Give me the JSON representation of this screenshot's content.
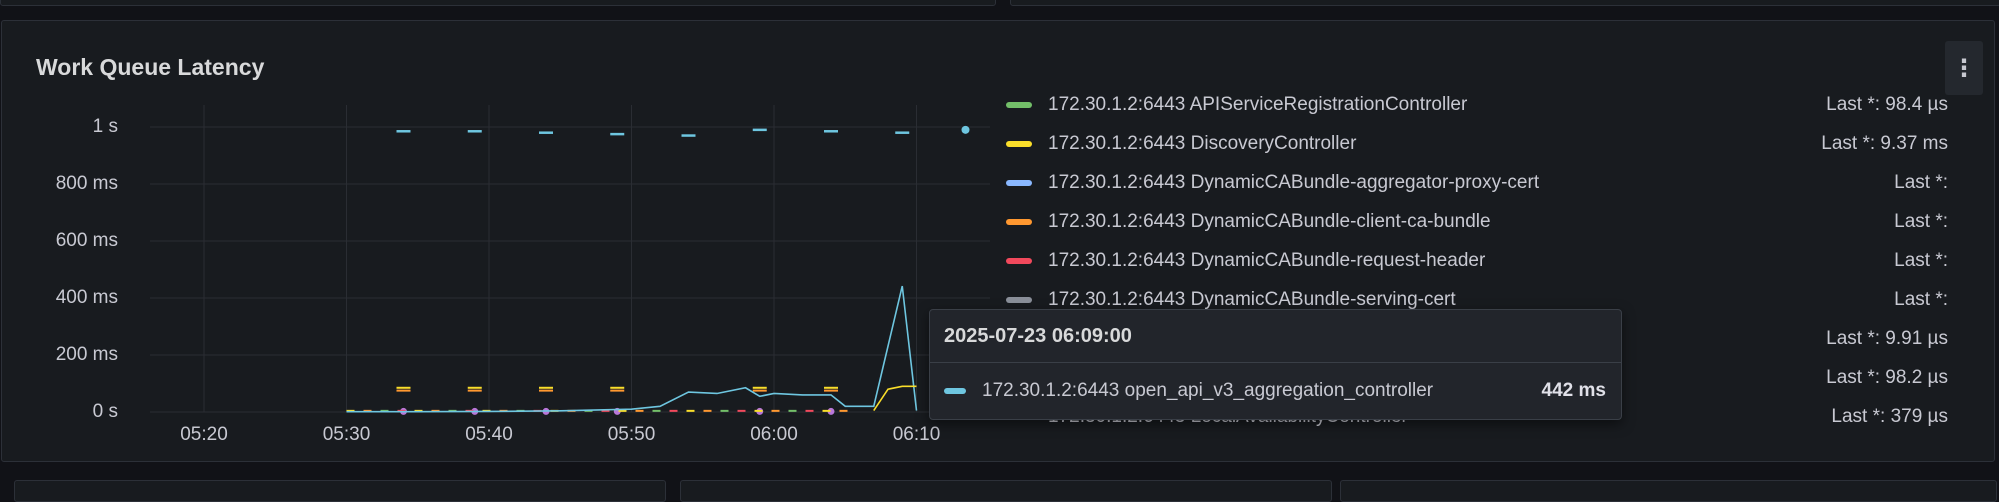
{
  "panel": {
    "title": "Work Queue Latency",
    "menu_icon": "kebab-menu-icon"
  },
  "colors": {
    "background": "#111217",
    "panel": "#181b1f",
    "grid": "#2a2d33",
    "green": "#73bf69",
    "yellow": "#fade2a",
    "blue": "#8ab8ff",
    "orange": "#ff9830",
    "red": "#f2495c",
    "cyan": "#6ec6e0",
    "dark_green": "#37872d"
  },
  "legend": [
    {
      "name": "172.30.1.2:6443 APIServiceRegistrationController",
      "last": "Last *: 98.4 µs",
      "color": "#73bf69"
    },
    {
      "name": "172.30.1.2:6443 DiscoveryController",
      "last": "Last *: 9.37 ms",
      "color": "#fade2a"
    },
    {
      "name": "172.30.1.2:6443 DynamicCABundle-aggregator-proxy-cert",
      "last": "Last *:",
      "color": "#8ab8ff"
    },
    {
      "name": "172.30.1.2:6443 DynamicCABundle-client-ca-bundle",
      "last": "Last *:",
      "color": "#ff9830"
    },
    {
      "name": "172.30.1.2:6443 DynamicCABundle-request-header",
      "last": "Last *:",
      "color": "#f2495c"
    },
    {
      "name": "172.30.1.2:6443 DynamicCABundle-serving-cert",
      "last": "Last *:",
      "color": "#8a8f99"
    },
    {
      "name": "",
      "last": "Last *: 9.91 µs",
      "color": "#b877d9"
    },
    {
      "name": "",
      "last": "Last *: 98.2 µs",
      "color": "#6ec6e0"
    },
    {
      "name": "172.30.1.2:6443 LocalAvailabilityController",
      "last": "Last *: 379 µs",
      "color": "#37872d"
    }
  ],
  "tooltip": {
    "time": "2025-07-23 06:09:00",
    "series": "172.30.1.2:6443 open_api_v3_aggregation_controller",
    "value": "442 ms"
  },
  "chart_data": {
    "type": "line",
    "y_unit": "s",
    "ylim": [
      0,
      1.1
    ],
    "y_ticks": [
      "1 s",
      "800 ms",
      "600 ms",
      "400 ms",
      "200 ms",
      "0 s"
    ],
    "y_tick_values": [
      1.0,
      0.8,
      0.6,
      0.4,
      0.2,
      0.0
    ],
    "x_ticks": [
      "05:20",
      "05:30",
      "05:40",
      "05:50",
      "06:00",
      "06:10"
    ],
    "grid": true,
    "series": [
      {
        "name": "172.30.1.2:6443 open_api_v3_aggregation_controller",
        "color": "#6ec6e0",
        "points": [
          [
            "05:30",
            0.001
          ],
          [
            "05:35",
            0.001
          ],
          [
            "05:40",
            0.002
          ],
          [
            "05:45",
            0.004
          ],
          [
            "05:50",
            0.01
          ],
          [
            "05:52",
            0.02
          ],
          [
            "05:54",
            0.07
          ],
          [
            "05:56",
            0.065
          ],
          [
            "05:58",
            0.085
          ],
          [
            "05:59",
            0.055
          ],
          [
            "06:00",
            0.065
          ],
          [
            "06:02",
            0.06
          ],
          [
            "06:04",
            0.06
          ],
          [
            "06:05",
            0.02
          ],
          [
            "06:07",
            0.02
          ],
          [
            "06:09",
            0.442
          ],
          [
            "06:10",
            0.005
          ]
        ]
      }
    ],
    "upper_dashes": [
      {
        "x": "05:34",
        "y": 0.985
      },
      {
        "x": "05:39",
        "y": 0.985
      },
      {
        "x": "05:44",
        "y": 0.98
      },
      {
        "x": "05:49",
        "y": 0.975
      },
      {
        "x": "05:54",
        "y": 0.97
      },
      {
        "x": "05:59",
        "y": 0.99
      },
      {
        "x": "06:04",
        "y": 0.985
      },
      {
        "x": "06:09",
        "y": 0.98
      },
      {
        "x": "06:14",
        "y": 0.99
      }
    ]
  }
}
